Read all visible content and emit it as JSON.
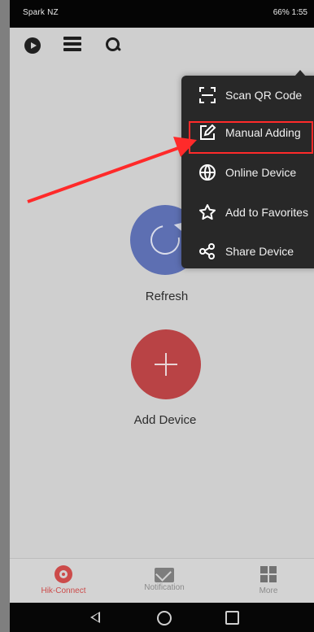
{
  "status_bar": {
    "carrier": "Spark NZ",
    "right_text": "66% 1:55"
  },
  "toolbar": {
    "icons": [
      "play-icon",
      "list-icon",
      "search-icon",
      "add-circle-icon"
    ]
  },
  "main": {
    "refresh_label": "Refresh",
    "add_device_label": "Add Device"
  },
  "menu": {
    "items": [
      {
        "label": "Scan QR Code",
        "icon": "scan-qr-icon"
      },
      {
        "label": "Manual Adding",
        "icon": "manual-adding-icon"
      },
      {
        "label": "Online Device",
        "icon": "online-device-icon"
      },
      {
        "label": "Add to Favorites",
        "icon": "favorites-icon"
      },
      {
        "label": "Share Device",
        "icon": "share-icon"
      }
    ]
  },
  "tabs": [
    {
      "label": "Hik-Connect",
      "icon": "hik-connect-icon",
      "active": true
    },
    {
      "label": "Notification",
      "icon": "mail-icon",
      "active": false
    },
    {
      "label": "More",
      "icon": "grid-icon",
      "active": false
    }
  ],
  "colors": {
    "highlight_box": "#ff2a2a",
    "arrow": "#ff2a2a",
    "active_tab": "#cc4b4a",
    "menu_bg": "#282828",
    "refresh_button": "#5d6fb2",
    "add_button": "#b94345"
  }
}
